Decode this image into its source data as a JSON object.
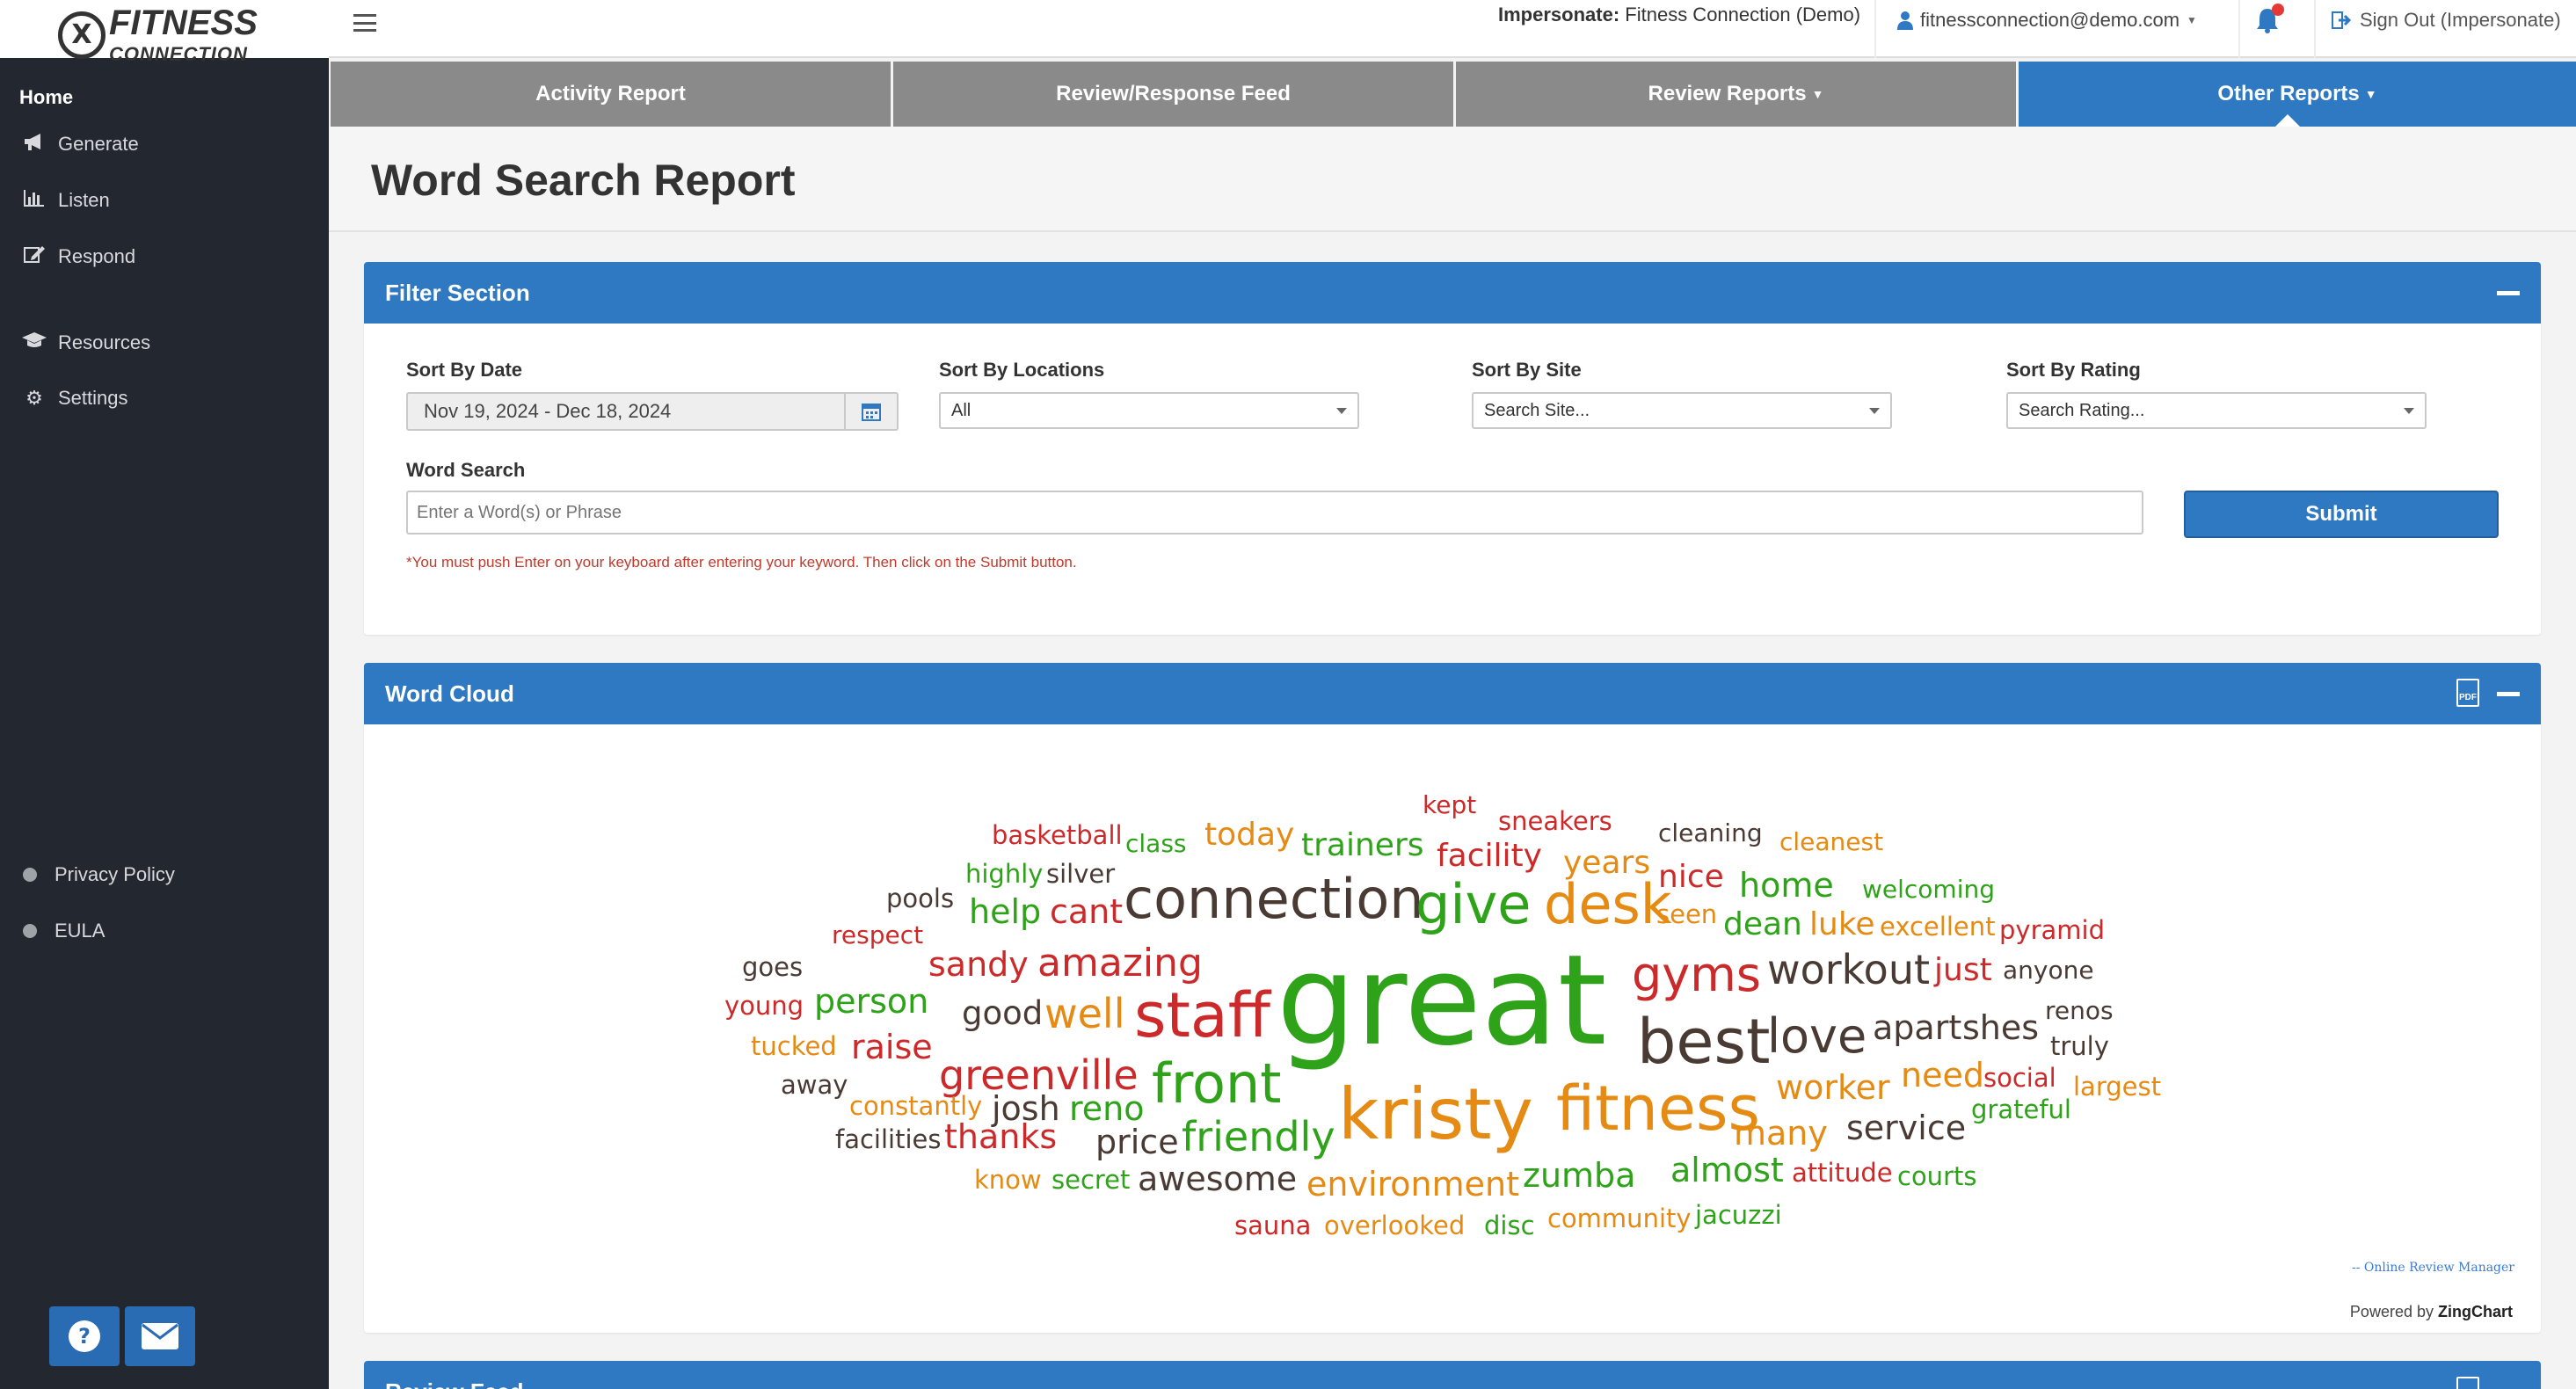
{
  "brand": {
    "line1": "FITNESS",
    "line2": "CONNECTION",
    "logo_glyph": "X"
  },
  "sidebar": {
    "home": "Home",
    "items": [
      {
        "label": "Generate",
        "icon": "megaphone-icon"
      },
      {
        "label": "Listen",
        "icon": "bar-chart-icon"
      },
      {
        "label": "Respond",
        "icon": "edit-icon"
      },
      {
        "label": "Resources",
        "icon": "graduation-cap-icon"
      },
      {
        "label": "Settings",
        "icon": "gear-icon"
      }
    ],
    "footer_links": [
      "Privacy Policy",
      "EULA"
    ]
  },
  "topbar": {
    "impersonate_label": "Impersonate:",
    "impersonate_value": "Fitness Connection (Demo)",
    "user_email": "fitnessconnection@demo.com",
    "signout": "Sign Out (Impersonate)"
  },
  "tabs": [
    {
      "label": "Activity Report",
      "dropdown": false
    },
    {
      "label": "Review/Response Feed",
      "dropdown": false
    },
    {
      "label": "Review Reports",
      "dropdown": true
    },
    {
      "label": "Other Reports",
      "dropdown": true,
      "active": true
    }
  ],
  "page_title": "Word Search Report",
  "filter": {
    "title": "Filter Section",
    "date_label": "Sort By Date",
    "date_value": "Nov 19, 2024 - Dec 18, 2024",
    "locations_label": "Sort By Locations",
    "locations_value": "All",
    "site_label": "Sort By Site",
    "site_placeholder": "Search Site...",
    "rating_label": "Sort By Rating",
    "rating_placeholder": "Search Rating...",
    "word_label": "Word Search",
    "word_placeholder": "Enter a Word(s) or Phrase",
    "submit": "Submit",
    "hint": "*You must push Enter on your keyboard after entering your keyword. Then click on the Submit button."
  },
  "word_cloud": {
    "title": "Word Cloud",
    "credit": "-- Online Review Manager",
    "powered_by": "Powered by",
    "powered_brand": "ZingChart",
    "colors": {
      "red": "#cc2a2a",
      "green": "#2ea31a",
      "brown": "#4a3a34",
      "orange": "#e58a13"
    },
    "words": [
      "kept",
      "sneakers",
      "basketball",
      "class",
      "today",
      "trainers",
      "facility",
      "cleaning",
      "cleanest",
      "years",
      "highly",
      "silver",
      "nice",
      "welcoming",
      "home",
      "pools",
      "connection",
      "give",
      "desk",
      "help",
      "cant",
      "seen",
      "respect",
      "dean",
      "luke",
      "excellent",
      "pyramid",
      "goes",
      "sandy",
      "amazing",
      "gyms",
      "workout",
      "just",
      "anyone",
      "young",
      "person",
      "good",
      "well",
      "staff",
      "great",
      "renos",
      "apart",
      "shes",
      "tucked",
      "raise",
      "best",
      "love",
      "truly",
      "away",
      "greenville",
      "need",
      "social",
      "largest",
      "front",
      "worker",
      "constantly",
      "josh",
      "reno",
      "grateful",
      "fitness",
      "service",
      "facilities",
      "thanks",
      "price",
      "friendly",
      "kristy",
      "many",
      "know",
      "secret",
      "awesome",
      "environment",
      "zumba",
      "almost",
      "attitude",
      "courts",
      "community",
      "jacuzzi",
      "sauna",
      "overlooked",
      "disc"
    ]
  },
  "review_feed": {
    "title": "Review Feed"
  }
}
